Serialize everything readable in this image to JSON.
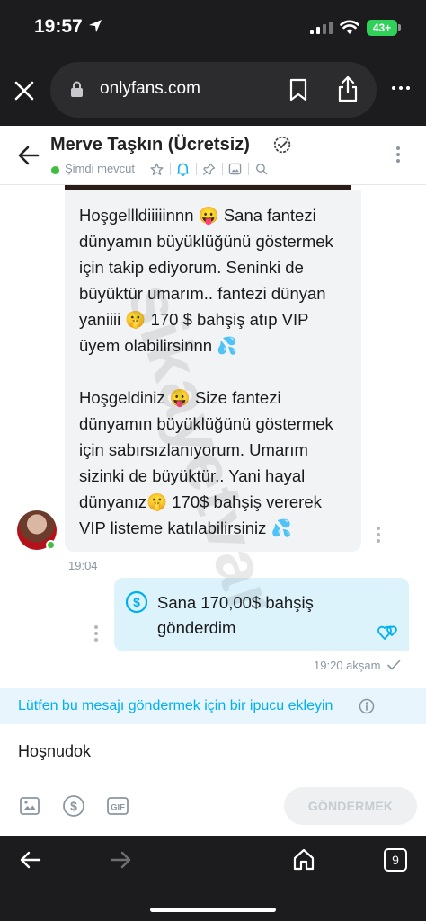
{
  "status_bar": {
    "time": "19:57",
    "battery": "43+"
  },
  "browser": {
    "url": "onlyfans.com",
    "tabs_count": "9"
  },
  "chat_header": {
    "name": "Merve Taşkın (Ücretsiz)",
    "status": "Şimdi mevcut",
    "tools": [
      "star-icon",
      "bell-icon",
      "pin-icon",
      "image-icon",
      "search-icon"
    ]
  },
  "messages": {
    "incoming": {
      "text": "Hoşgellldiiiiinnn 😛 Sana fantezi\ndünyamın büyüklüğünü göstermek\niçin takip ediyorum. Seninki de\nbüyüktür umarım.. fantezi dünyan\nyaniiii 🤫 170 $ bahşiş atıp VIP\nüyem olabilirsinnn 💦\n\nHoşgeldiniz 😛 Size fantezi\ndünyamın büyüklüğünü göstermek\niçin sabırsızlanıyorum. Umarım\nsizinki de büyüktür.. Yani hayal\ndünyanız🤫 170$ bahşiş vererek\nVIP listeme katılabilirsiniz 💦",
      "time": "19:04"
    },
    "outgoing": {
      "text": "Sana 170,00$ bahşiş\ngönderdim",
      "time": "19:20 akşam"
    }
  },
  "notice": {
    "text": "Lütfen bu mesajı göndermek için bir ipucu ekleyin"
  },
  "composer": {
    "value": "Hoşnudok",
    "send_label": "GÖNDERMEK"
  },
  "colors": {
    "accent": "#00aff0",
    "chrome": "#1c1c1e",
    "incoming_bubble": "#f2f3f5",
    "outgoing_bubble": "#dcf3fc",
    "online": "#3fbf3f"
  },
  "watermark": "sikayetvar"
}
